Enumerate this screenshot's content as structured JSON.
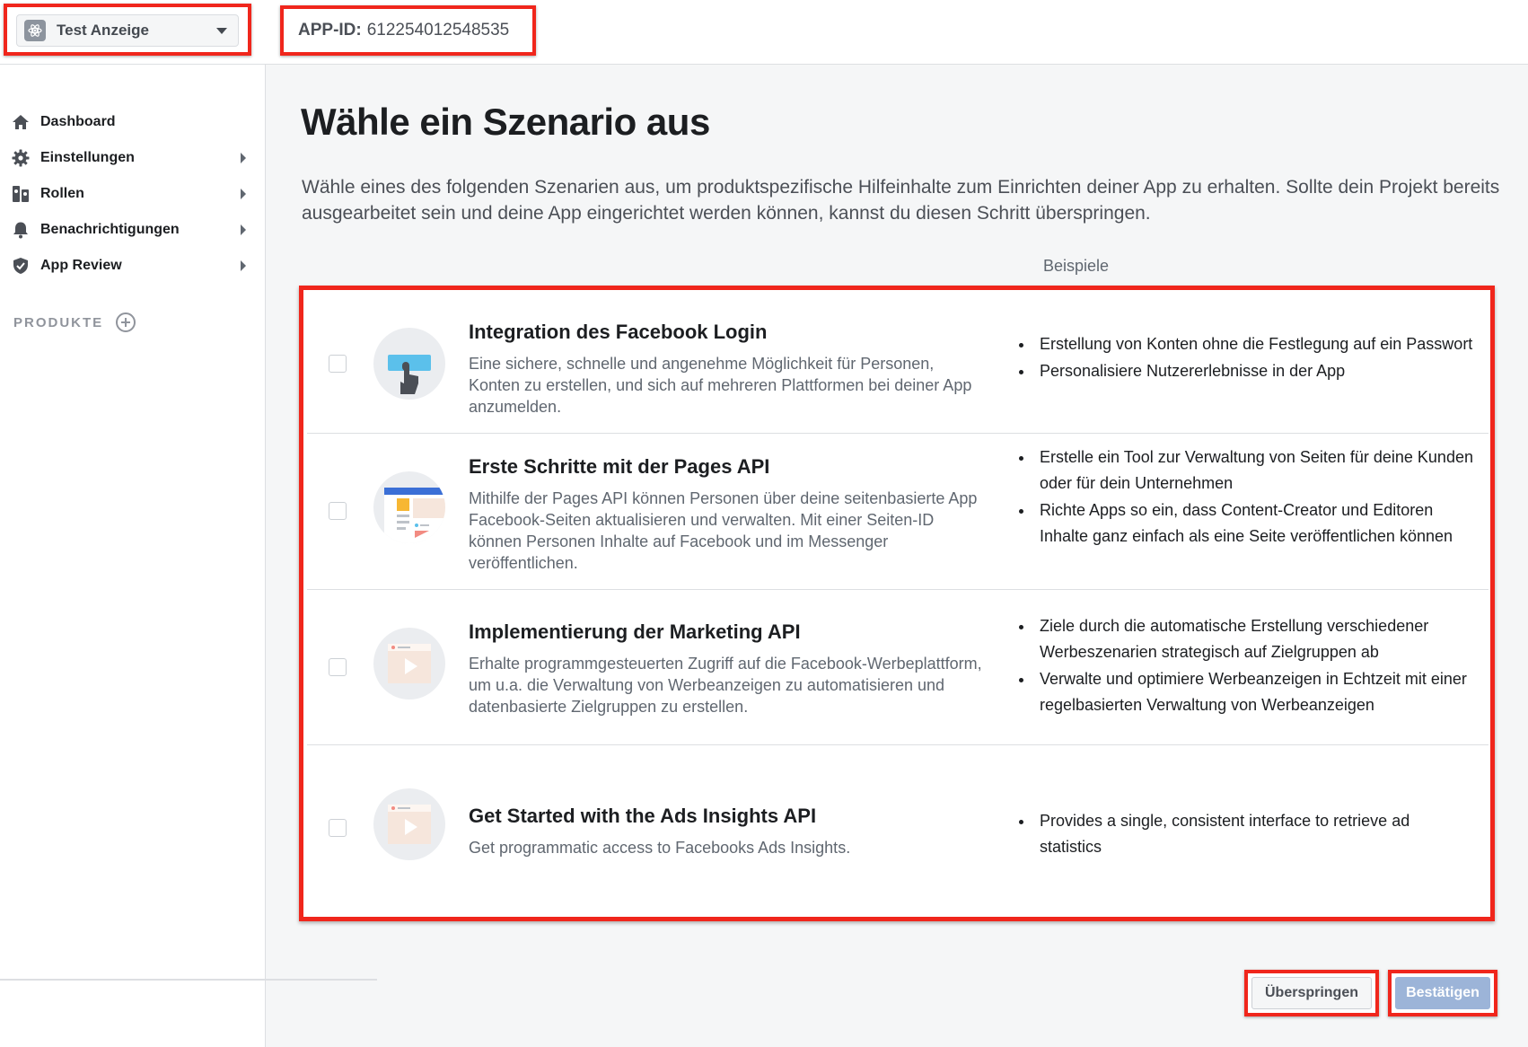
{
  "header": {
    "app_name": "Test Anzeige",
    "app_id_label": "APP-ID:",
    "app_id_value": "612254012548535"
  },
  "sidebar": {
    "items": [
      {
        "label": "Dashboard",
        "icon": "home-icon",
        "has_arrow": false
      },
      {
        "label": "Einstellungen",
        "icon": "gear-icon",
        "has_arrow": true
      },
      {
        "label": "Rollen",
        "icon": "roles-icon",
        "has_arrow": true
      },
      {
        "label": "Benachrichtigungen",
        "icon": "bell-icon",
        "has_arrow": true
      },
      {
        "label": "App Review",
        "icon": "shield-check-icon",
        "has_arrow": true
      }
    ],
    "products_label": "PRODUKTE"
  },
  "main": {
    "title": "Wähle ein Szenario aus",
    "intro": "Wähle eines des folgenden Szenarien aus, um produktspezifische Hilfeinhalte zum Einrichten deiner App zu erhalten. Sollte dein Projekt bereits ausgearbeitet sein und deine App eingerichtet werden können, kannst du diesen Schritt überspringen.",
    "examples_header": "Beispiele",
    "scenarios": [
      {
        "title": "Integration des Facebook Login",
        "description": "Eine sichere, schnelle und angenehme Möglichkeit für Personen, Konten zu erstellen, und sich auf mehreren Plattformen bei deiner App anzumelden.",
        "icon": "facebook-login-illustration",
        "examples": [
          "Erstellung von Konten ohne die Festlegung auf ein Passwort",
          "Personalisiere Nutzererlebnisse in der App"
        ]
      },
      {
        "title": "Erste Schritte mit der Pages API",
        "description": "Mithilfe der Pages API können Personen über deine seitenbasierte App Facebook-Seiten aktualisieren und verwalten. Mit einer Seiten-ID können Personen Inhalte auf Facebook und im Messenger veröffentlichen.",
        "icon": "pages-api-illustration",
        "examples": [
          "Erstelle ein Tool zur Verwaltung von Seiten für deine Kunden oder für dein Unternehmen",
          "Richte Apps so ein, dass Content-Creator und Editoren Inhalte ganz einfach als eine Seite veröffentlichen können"
        ]
      },
      {
        "title": "Implementierung der Marketing API",
        "description": "Erhalte programmgesteuerten Zugriff auf die Facebook-Werbeplattform, um u.a. die Verwaltung von Werbeanzeigen zu automatisieren und datenbasierte Zielgruppen zu erstellen.",
        "icon": "marketing-api-illustration",
        "examples": [
          "Ziele durch die automatische Erstellung verschiedener Werbeszenarien strategisch auf Zielgruppen ab",
          "Verwalte und optimiere Werbeanzeigen in Echtzeit mit einer regelbasierten Verwaltung von Werbeanzeigen"
        ]
      },
      {
        "title": "Get Started with the Ads Insights API",
        "description": "Get programmatic access to Facebooks Ads Insights.",
        "icon": "ads-insights-illustration",
        "examples": [
          "Provides a single, consistent interface to retrieve ad statistics"
        ]
      }
    ]
  },
  "footer": {
    "skip_label": "Überspringen",
    "confirm_label": "Bestätigen"
  },
  "colors": {
    "highlight_border": "#f0261c",
    "confirm_button": "#9cb4d8",
    "page_background": "#f5f6f7"
  }
}
